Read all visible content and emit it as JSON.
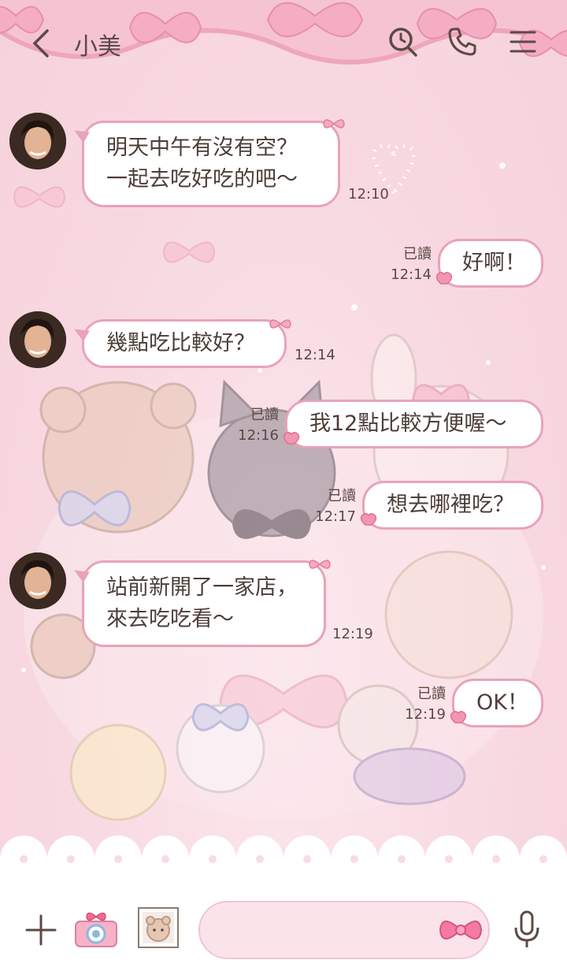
{
  "header": {
    "title": "小美",
    "icons": [
      "back-chevron-icon",
      "search-icon",
      "phone-icon",
      "menu-icon"
    ]
  },
  "messages": [
    {
      "side": "left",
      "lines": [
        "明天中午有沒有空？",
        "一起去吃好吃的吧～"
      ],
      "time": "12:10"
    },
    {
      "side": "right",
      "lines": [
        "好啊！"
      ],
      "read": "已讀",
      "time": "12:14"
    },
    {
      "side": "left",
      "lines": [
        "幾點吃比較好？"
      ],
      "time": "12:14"
    },
    {
      "side": "right",
      "lines": [
        "我12點比較方便喔～"
      ],
      "read": "已讀",
      "time": "12:16"
    },
    {
      "side": "right",
      "lines": [
        "想去哪裡吃？"
      ],
      "read": "已讀",
      "time": "12:17"
    },
    {
      "side": "left",
      "lines": [
        "站前新開了一家店，",
        "來去吃吃看～"
      ],
      "time": "12:19"
    },
    {
      "side": "right",
      "lines": [
        "OK！"
      ],
      "read": "已讀",
      "time": "12:19"
    }
  ],
  "footer": {
    "icons": [
      "plus-icon",
      "camera-icon",
      "sticker-icon",
      "bow-emoji-icon",
      "microphone-icon"
    ],
    "input_placeholder": ""
  },
  "colors": {
    "background": "#f9dbe3",
    "bubble_border": "#e8a3b8",
    "bubble_fill": "#ffffff",
    "text": "#5b4a44",
    "footer": "#ffffff"
  }
}
